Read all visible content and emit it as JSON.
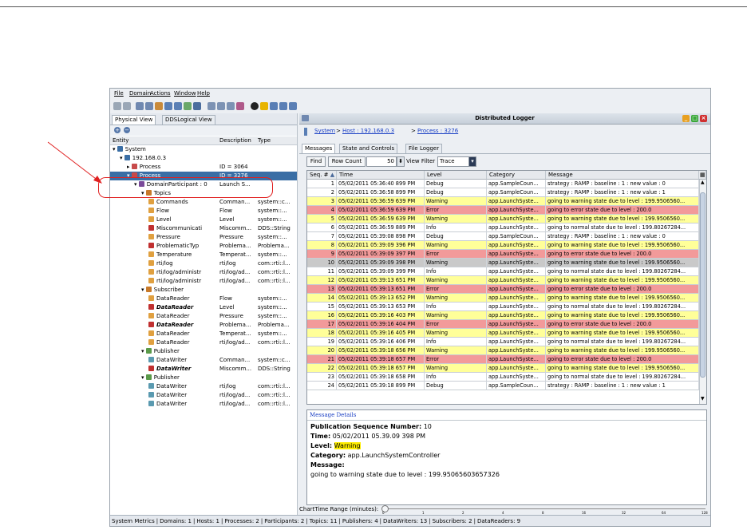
{
  "menu": [
    "File",
    "Domain",
    "Actions",
    "Window",
    "Help"
  ],
  "left": {
    "tabs": [
      "Physical View",
      "DDSLogical View"
    ],
    "columns": [
      "Entity",
      "Description",
      "Type"
    ],
    "tree": [
      {
        "name": "System",
        "desc": "",
        "type": "",
        "indent": 0,
        "icon": "system",
        "sel": false
      },
      {
        "name": "192.168.0.3",
        "desc": "",
        "type": "",
        "indent": 1,
        "icon": "host",
        "sel": false
      },
      {
        "name": "Process",
        "desc": "ID = 3064",
        "type": "",
        "indent": 2,
        "icon": "process",
        "sel": false
      },
      {
        "name": "Process",
        "desc": "ID = 3276",
        "type": "",
        "indent": 2,
        "icon": "process",
        "sel": true
      },
      {
        "name": "DomainParticipant : 0",
        "desc": "Launch S...",
        "type": "",
        "indent": 3,
        "icon": "participant",
        "sel": false
      },
      {
        "name": "Topics",
        "desc": "",
        "type": "",
        "indent": 4,
        "icon": "topics",
        "sel": false
      },
      {
        "name": "Commands",
        "desc": "Comman...",
        "type": "system::c...",
        "indent": 5,
        "icon": "topic",
        "sel": false
      },
      {
        "name": "Flow",
        "desc": "Flow",
        "type": "system::...",
        "indent": 5,
        "icon": "topic",
        "sel": false
      },
      {
        "name": "Level",
        "desc": "Level",
        "type": "system::...",
        "indent": 5,
        "icon": "topic",
        "sel": false
      },
      {
        "name": "Miscommunicati",
        "desc": "Miscomm...",
        "type": "DDS::String",
        "indent": 5,
        "icon": "topicerr",
        "sel": false
      },
      {
        "name": "Pressure",
        "desc": "Pressure",
        "type": "system::...",
        "indent": 5,
        "icon": "topic",
        "sel": false
      },
      {
        "name": "ProblematicTyp",
        "desc": "Problema...",
        "type": "Problema...",
        "indent": 5,
        "icon": "topicerr",
        "sel": false
      },
      {
        "name": "Temperature",
        "desc": "Temperat...",
        "type": "system::...",
        "indent": 5,
        "icon": "topic",
        "sel": false
      },
      {
        "name": "rti/log",
        "desc": "rti/log",
        "type": "com::rti::l...",
        "indent": 5,
        "icon": "topic",
        "sel": false
      },
      {
        "name": "rti/log/administr",
        "desc": "rti/log/ad...",
        "type": "com::rti::l...",
        "indent": 5,
        "icon": "topic",
        "sel": false
      },
      {
        "name": "rti/log/administr",
        "desc": "rti/log/ad...",
        "type": "com::rti::l...",
        "indent": 5,
        "icon": "topic",
        "sel": false
      },
      {
        "name": "Subscriber",
        "desc": "",
        "type": "",
        "indent": 4,
        "icon": "subscriber",
        "sel": false
      },
      {
        "name": "DataReader",
        "desc": "Flow",
        "type": "system::...",
        "indent": 5,
        "icon": "reader",
        "sel": false
      },
      {
        "name": "DataReader",
        "desc": "Level",
        "type": "system::...",
        "indent": 5,
        "icon": "readerb",
        "sel": false
      },
      {
        "name": "DataReader",
        "desc": "Pressure",
        "type": "system::...",
        "indent": 5,
        "icon": "reader",
        "sel": false
      },
      {
        "name": "DataReader",
        "desc": "Problema...",
        "type": "Problema...",
        "indent": 5,
        "icon": "readerb",
        "sel": false
      },
      {
        "name": "DataReader",
        "desc": "Temperat...",
        "type": "system::...",
        "indent": 5,
        "icon": "reader",
        "sel": false
      },
      {
        "name": "DataReader",
        "desc": "rti/log/ad...",
        "type": "com::rti::l...",
        "indent": 5,
        "icon": "reader",
        "sel": false
      },
      {
        "name": "Publisher",
        "desc": "",
        "type": "",
        "indent": 4,
        "icon": "publisher",
        "sel": false
      },
      {
        "name": "DataWriter",
        "desc": "Comman...",
        "type": "system::c...",
        "indent": 5,
        "icon": "writer",
        "sel": false
      },
      {
        "name": "DataWriter",
        "desc": "Miscomm...",
        "type": "DDS::String",
        "indent": 5,
        "icon": "writerb",
        "sel": false
      },
      {
        "name": "Publisher",
        "desc": "",
        "type": "",
        "indent": 4,
        "icon": "publisher",
        "sel": false
      },
      {
        "name": "DataWriter",
        "desc": "rti/log",
        "type": "com::rti::l...",
        "indent": 5,
        "icon": "writer",
        "sel": false
      },
      {
        "name": "DataWriter",
        "desc": "rti/log/ad...",
        "type": "com::rti::l...",
        "indent": 5,
        "icon": "writer",
        "sel": false
      },
      {
        "name": "DataWriter",
        "desc": "rti/log/ad...",
        "type": "com::rti::l...",
        "indent": 5,
        "icon": "writer",
        "sel": false
      }
    ]
  },
  "logger": {
    "title": "Distributed Logger",
    "crumbs": [
      "System",
      "Host : 192.168.0.3",
      "Process : 3276"
    ],
    "crumb_sep": ">",
    "tabs": [
      "Messages",
      "State and Controls",
      "File Logger"
    ],
    "find_label": "Find",
    "row_count_label": "Row Count",
    "row_count_value": "50",
    "view_filter_label": "View Filter",
    "view_filter_value": "Trace",
    "columns": [
      "Seq. #",
      "Time",
      "Level",
      "Category",
      "Message"
    ],
    "sort_indicator": "▲",
    "rows": [
      [
        "1",
        "05/02/2011 05:36:40 899 PM",
        "Debug",
        "app.SampleCoun...",
        "strategy : RAMP : baseline : 1 : new value : 0"
      ],
      [
        "2",
        "05/02/2011 05:36:58 899 PM",
        "Debug",
        "app.SampleCoun...",
        "strategy : RAMP : baseline : 1 : new value : 1"
      ],
      [
        "3",
        "05/02/2011 05:36:59 639 PM",
        "Warning",
        "app.LaunchSyste...",
        "going to warning state due to level : 199.9506560..."
      ],
      [
        "4",
        "05/02/2011 05:36:59 639 PM",
        "Error",
        "app.LaunchSyste...",
        "going to error state due to level : 200.0"
      ],
      [
        "5",
        "05/02/2011 05:36:59 639 PM",
        "Warning",
        "app.LaunchSyste...",
        "going to warning state due to level : 199.9506560..."
      ],
      [
        "6",
        "05/02/2011 05:36:59 889 PM",
        "Info",
        "app.LaunchSyste...",
        "going to normal state due to level : 199.80267284..."
      ],
      [
        "7",
        "05/02/2011 05:39:08 898 PM",
        "Debug",
        "app.SampleCoun...",
        "strategy : RAMP : baseline : 1 : new value : 0"
      ],
      [
        "8",
        "05/02/2011 05:39:09 396 PM",
        "Warning",
        "app.LaunchSyste...",
        "going to warning state due to level : 199.9506560..."
      ],
      [
        "9",
        "05/02/2011 05:39:09 397 PM",
        "Error",
        "app.LaunchSyste...",
        "going to error state due to level : 200.0"
      ],
      [
        "10",
        "05/02/2011 05:39:09 398 PM",
        "Warning",
        "app.LaunchSyste...",
        "going to warning state due to level : 199.9506560..."
      ],
      [
        "11",
        "05/02/2011 05:39:09 399 PM",
        "Info",
        "app.LaunchSyste...",
        "going to normal state due to level : 199.80267284..."
      ],
      [
        "12",
        "05/02/2011 05:39:13 651 PM",
        "Warning",
        "app.LaunchSyste...",
        "going to warning state due to level : 199.9506560..."
      ],
      [
        "13",
        "05/02/2011 05:39:13 651 PM",
        "Error",
        "app.LaunchSyste...",
        "going to error state due to level : 200.0"
      ],
      [
        "14",
        "05/02/2011 05:39:13 652 PM",
        "Warning",
        "app.LaunchSyste...",
        "going to warning state due to level : 199.9506560..."
      ],
      [
        "15",
        "05/02/2011 05:39:13 653 PM",
        "Info",
        "app.LaunchSyste...",
        "going to normal state due to level : 199.80267284..."
      ],
      [
        "16",
        "05/02/2011 05:39:16 403 PM",
        "Warning",
        "app.LaunchSyste...",
        "going to warning state due to level : 199.9506560..."
      ],
      [
        "17",
        "05/02/2011 05:39:16 404 PM",
        "Error",
        "app.LaunchSyste...",
        "going to error state due to level : 200.0"
      ],
      [
        "18",
        "05/02/2011 05:39:16 405 PM",
        "Warning",
        "app.LaunchSyste...",
        "going to warning state due to level : 199.9506560..."
      ],
      [
        "19",
        "05/02/2011 05:39:16 406 PM",
        "Info",
        "app.LaunchSyste...",
        "going to normal state due to level : 199.80267284..."
      ],
      [
        "20",
        "05/02/2011 05:39:18 656 PM",
        "Warning",
        "app.LaunchSyste...",
        "going to warning state due to level : 199.9506560..."
      ],
      [
        "21",
        "05/02/2011 05:39:18 657 PM",
        "Error",
        "app.LaunchSyste...",
        "going to error state due to level : 200.0"
      ],
      [
        "22",
        "05/02/2011 05:39:18 657 PM",
        "Warning",
        "app.LaunchSyste...",
        "going to warning state due to level : 199.9506560..."
      ],
      [
        "23",
        "05/02/2011 05:39:18 658 PM",
        "Info",
        "app.LaunchSyste...",
        "going to normal state due to level : 199.80267284..."
      ],
      [
        "24",
        "05/02/2011 05:39:18 899 PM",
        "Debug",
        "app.SampleCoun...",
        "strategy : RAMP : baseline : 1 : new value : 1"
      ]
    ],
    "selected_seq": "10",
    "details": {
      "header": "Message Details",
      "seq_label": "Publication Sequence Number:",
      "seq_value": "10",
      "time_label": "Time:",
      "time_value": "05/02/2011 05.39.09 398 PM",
      "level_label": "Level:",
      "level_value": "Warning",
      "category_label": "Category:",
      "category_value": "app.LaunchSystemController",
      "message_label": "Message:",
      "message_value": "going to warning state due to level : 199.95065603657326"
    },
    "chart_label": "ChartTime Range (minutes):",
    "chart_ticks": [
      "0",
      "1",
      "2",
      "4",
      "8",
      "16",
      "32",
      "64",
      "128"
    ]
  },
  "status": [
    "System Metrics",
    "Domains: 1",
    "Hosts: 1",
    "Processes: 2",
    "Participants: 2",
    "Topics: 11",
    "Publishers: 4",
    "DataWriters: 13",
    "Subscribers: 2",
    "DataReaders: 9"
  ],
  "colors": {
    "Warning": "#ffff99",
    "Error": "#f29a9a",
    "Info": "#ffffff",
    "Debug": "#ffffff",
    "selected_row": "#c9c9c9",
    "selection": "#3a6ea5",
    "link": "#1a3fc4",
    "callout": "#e02020"
  }
}
